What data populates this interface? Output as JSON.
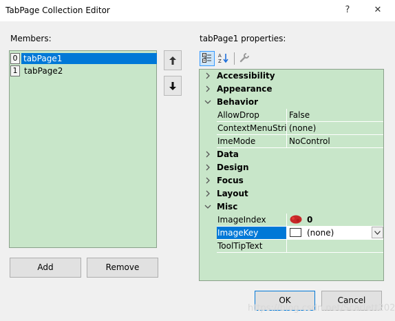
{
  "window": {
    "title": "TabPage Collection Editor",
    "help_glyph": "?",
    "close_glyph": "✕"
  },
  "members": {
    "label": "Members:",
    "items": [
      {
        "index": "0",
        "name": "tabPage1",
        "selected": true
      },
      {
        "index": "1",
        "name": "tabPage2",
        "selected": false
      }
    ],
    "move_up_icon": "arrow-up-icon",
    "move_down_icon": "arrow-down-icon",
    "add_label": "Add",
    "remove_label": "Remove"
  },
  "properties": {
    "label": "tabPage1 properties:",
    "toolbar": [
      "categorized-icon",
      "alphabetical-icon",
      "property-pages-icon"
    ],
    "rows": [
      {
        "type": "category",
        "label": "Accessibility",
        "expanded": false
      },
      {
        "type": "category",
        "label": "Appearance",
        "expanded": false
      },
      {
        "type": "category",
        "label": "Behavior",
        "expanded": true
      },
      {
        "type": "property",
        "name": "AllowDrop",
        "value": "False"
      },
      {
        "type": "property",
        "name": "ContextMenuStrip",
        "value": "(none)"
      },
      {
        "type": "property",
        "name": "ImeMode",
        "value": "NoControl"
      },
      {
        "type": "category",
        "label": "Data",
        "expanded": false
      },
      {
        "type": "category",
        "label": "Design",
        "expanded": false
      },
      {
        "type": "category",
        "label": "Focus",
        "expanded": false
      },
      {
        "type": "category",
        "label": "Layout",
        "expanded": false
      },
      {
        "type": "category",
        "label": "Misc",
        "expanded": true
      },
      {
        "type": "property",
        "name": "ImageIndex",
        "value": "0"
      },
      {
        "type": "property",
        "name": "ImageKey",
        "value": "(none)"
      },
      {
        "type": "property",
        "name": "ToolTipText",
        "value": ""
      }
    ]
  },
  "buttons": {
    "ok_label": "OK",
    "cancel_label": "Cancel"
  },
  "watermark": "https://blog.csdn.net/Scarlett2025",
  "colors": {
    "accent": "#0078d7",
    "list_background": "#c8e6c9",
    "dialog_background": "#f0f0f0"
  }
}
